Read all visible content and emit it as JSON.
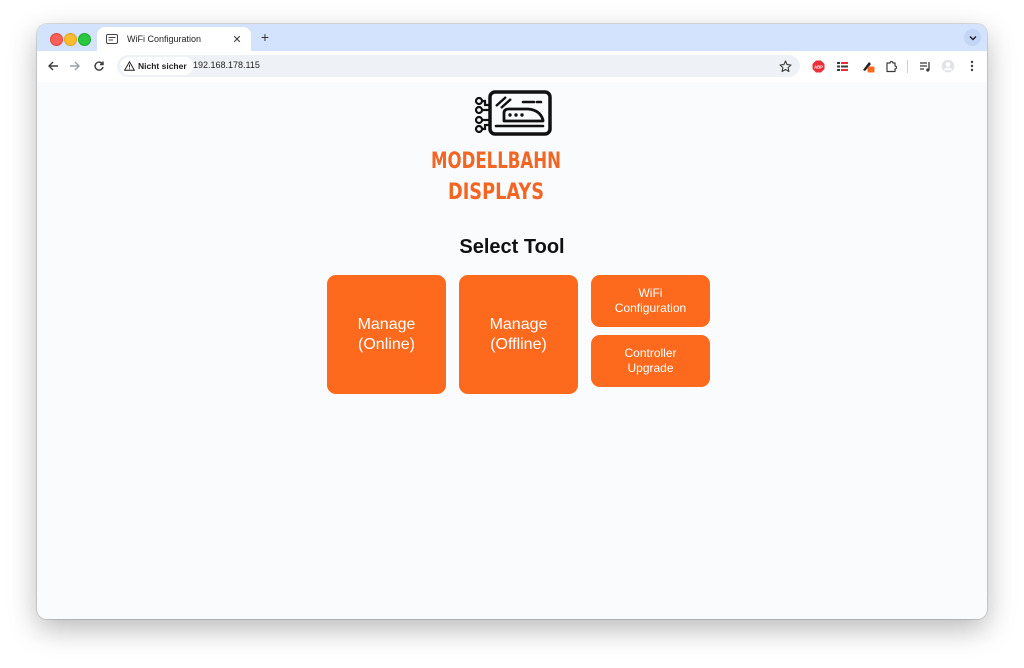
{
  "browser": {
    "tab": {
      "title": "WiFi Configuration"
    },
    "address_bar": {
      "security_label": "Nicht sicher",
      "url": "192.168.178.115"
    },
    "extensions": [
      "abp-icon",
      "tasks-icon",
      "pen-icon",
      "puzzle-icon",
      "media-icon",
      "profile-icon"
    ]
  },
  "page": {
    "logo": {
      "line1": "MODELLBAHN",
      "line2": "DISPLAYS"
    },
    "heading": "Select Tool",
    "tools": [
      {
        "label": "Manage\n(Online)"
      },
      {
        "label": "Manage\n(Offline)"
      },
      {
        "label": "WiFi\nConfiguration"
      },
      {
        "label": "Controller\nUpgrade"
      }
    ]
  },
  "colors": {
    "accent": "#fd6a1d",
    "tabstrip": "#d3e3fd",
    "page_background": "#f9fbfd"
  }
}
